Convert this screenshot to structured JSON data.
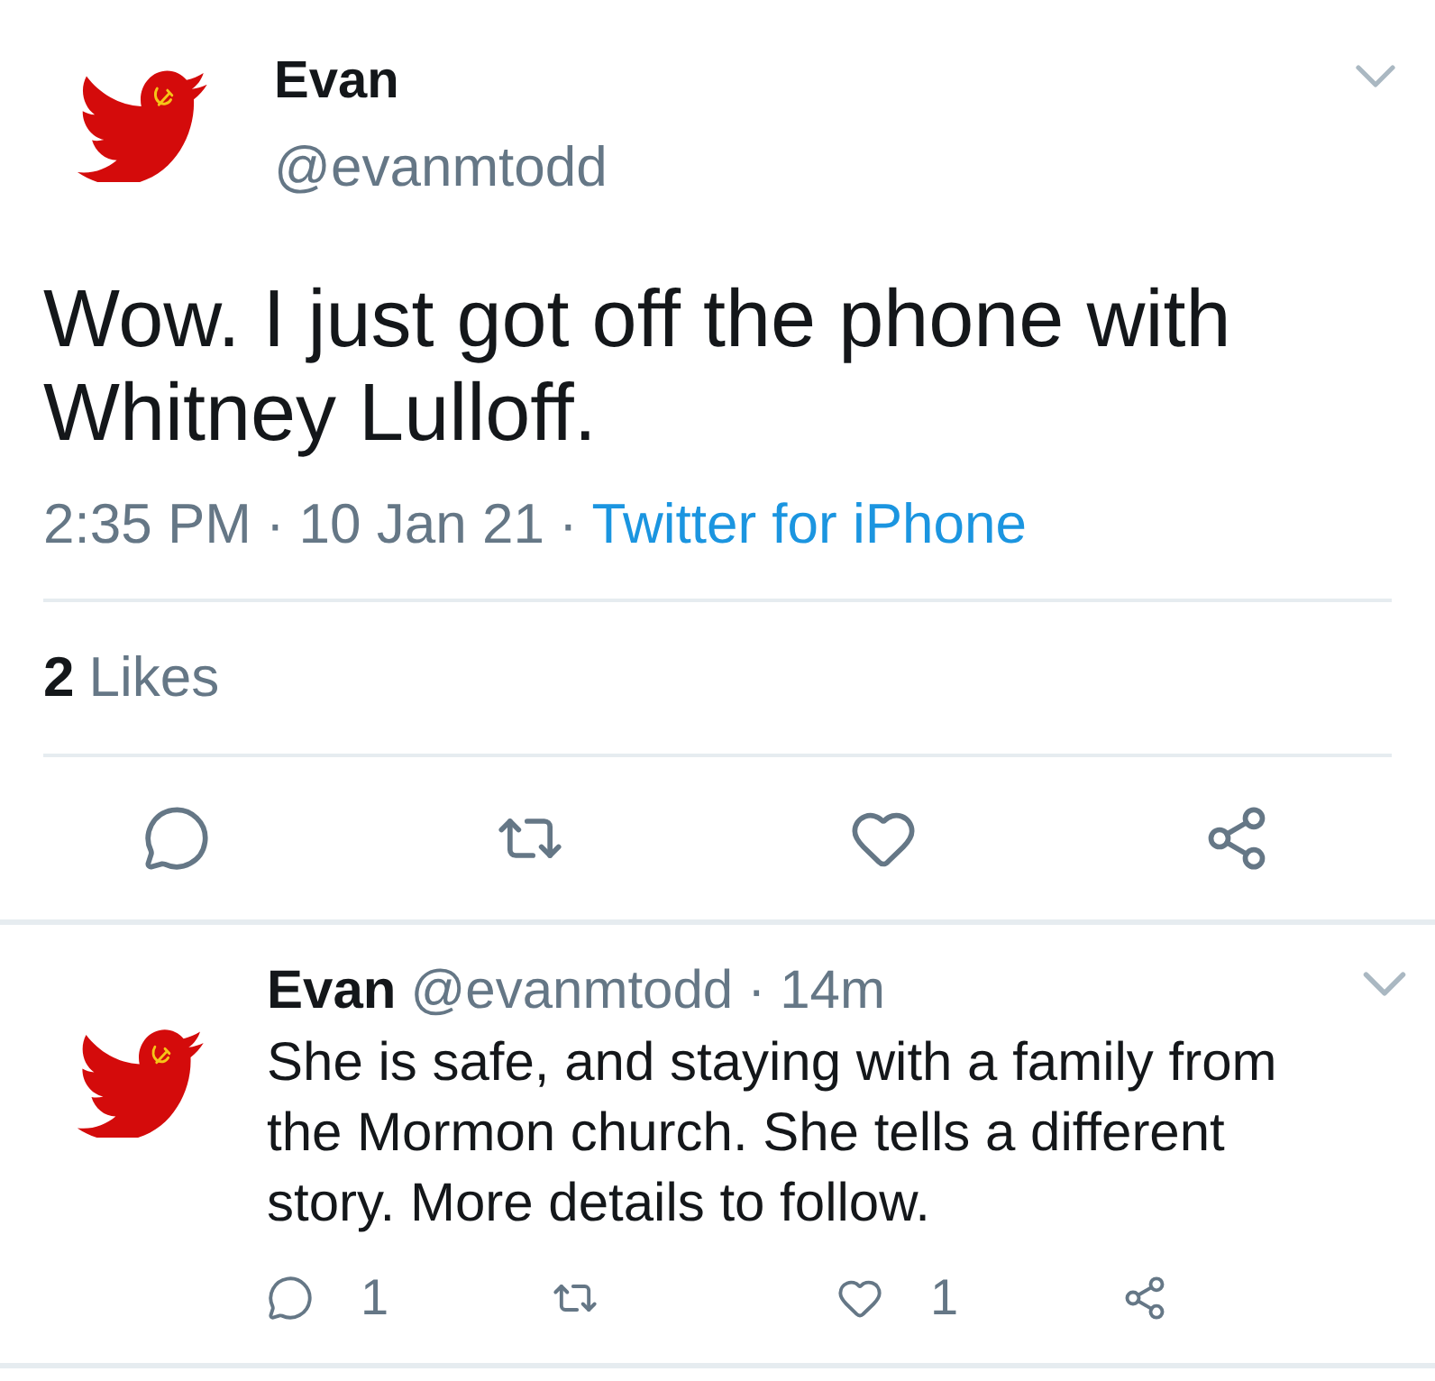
{
  "tweet": {
    "author": {
      "name": "Evan",
      "handle": "@evanmtodd"
    },
    "text": "Wow. I just got off the phone with Whitney Lulloff.",
    "meta": [
      {
        "kind": "text",
        "text": "2:35 PM"
      },
      {
        "kind": "separator",
        "text": "·"
      },
      {
        "kind": "text",
        "text": "10 Jan 21"
      },
      {
        "kind": "separator",
        "text": "·"
      },
      {
        "kind": "link",
        "text": "Twitter for iPhone"
      }
    ],
    "likes": {
      "count": "2",
      "label": "Likes"
    },
    "actions": [
      {
        "kind": "reply"
      },
      {
        "kind": "retweet"
      },
      {
        "kind": "like"
      },
      {
        "kind": "share"
      }
    ]
  },
  "replies": [
    {
      "name": "Evan",
      "handle": "@evanmtodd",
      "separator": "·",
      "time": "14m",
      "text": "She is safe, and staying with a family from the Mormon church. She tells a different story. More details to follow.",
      "actions": [
        {
          "kind": "reply",
          "count": "1"
        },
        {
          "kind": "retweet"
        },
        {
          "kind": "like",
          "count": "1"
        },
        {
          "kind": "share"
        }
      ]
    }
  ]
}
